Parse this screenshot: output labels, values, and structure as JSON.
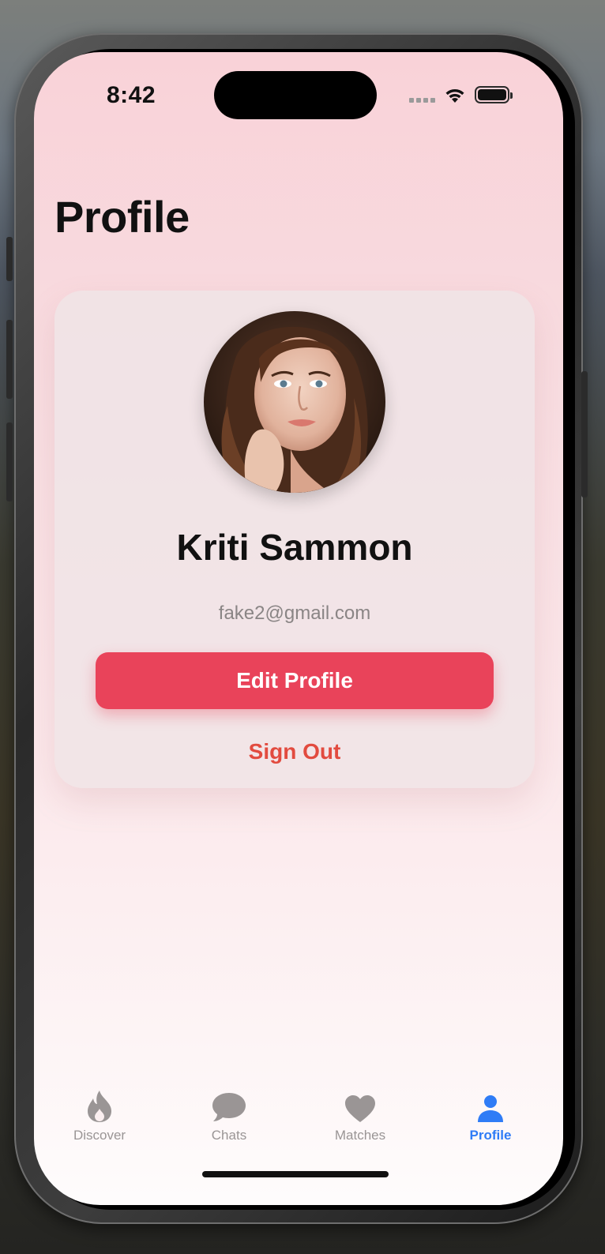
{
  "status_bar": {
    "time": "8:42"
  },
  "header": {
    "title": "Profile"
  },
  "profile": {
    "name": "Kriti Sammon",
    "email": "fake2@gmail.com",
    "edit_button_label": "Edit Profile",
    "sign_out_label": "Sign Out"
  },
  "tab_bar": {
    "items": [
      {
        "label": "Discover",
        "icon": "flame-icon"
      },
      {
        "label": "Chats",
        "icon": "chat-bubble-icon"
      },
      {
        "label": "Matches",
        "icon": "heart-icon"
      },
      {
        "label": "Profile",
        "icon": "person-icon"
      }
    ],
    "active": "Profile"
  },
  "colors": {
    "accent": "#e9435a",
    "sign_out": "#e24b3f",
    "tab_active": "#2f7cf6",
    "tab_inactive": "#9a9595"
  }
}
